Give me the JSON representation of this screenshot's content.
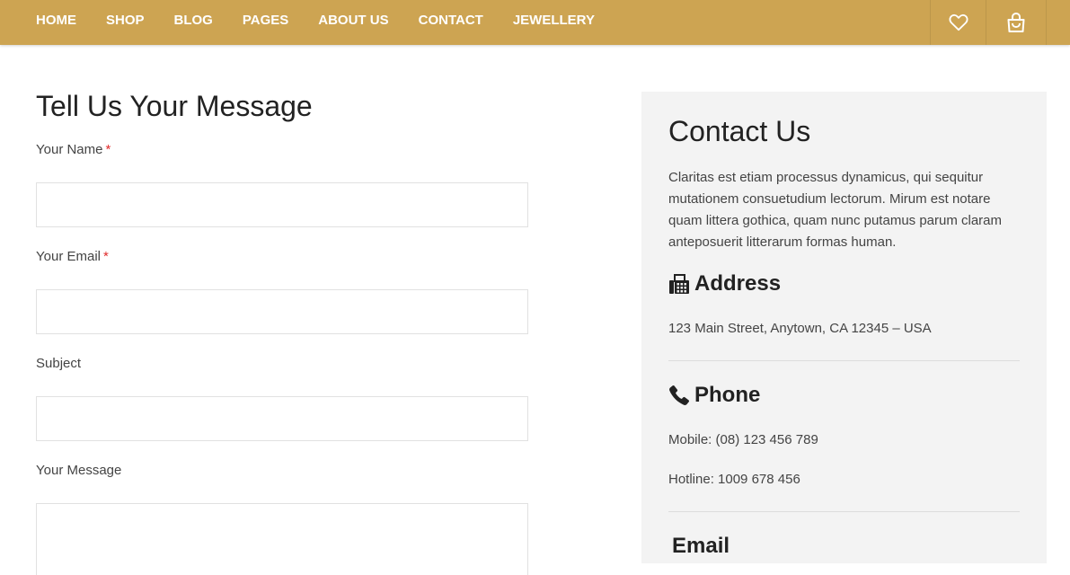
{
  "nav": {
    "links": [
      "HOME",
      "SHOP",
      "BLOG",
      "PAGES",
      "ABOUT US",
      "CONTACT",
      "JEWELLERY"
    ],
    "icons": [
      "heart-icon",
      "shopping-bag-icon"
    ]
  },
  "form": {
    "title": "Tell Us Your Message",
    "name_label": "Your Name",
    "name_required": "*",
    "email_label": "Your Email",
    "email_required": "*",
    "subject_label": "Subject",
    "message_label": "Your Message"
  },
  "contact": {
    "title": "Contact Us",
    "description": "Claritas est etiam processus dynamicus, qui sequitur mutationem consuetudium lectorum. Mirum est notare quam littera gothica, quam nunc putamus parum claram anteposuerit litterarum formas human.",
    "address": {
      "heading": "Address",
      "icon": "fax-icon",
      "text": "123 Main Street, Anytown, CA 12345 – USA"
    },
    "phone": {
      "heading": "Phone",
      "icon": "phone-icon",
      "mobile": "Mobile: (08) 123 456 789",
      "hotline": "Hotline: 1009 678 456"
    },
    "email": {
      "heading": "Email"
    }
  },
  "colors": {
    "nav_background": "#cda452",
    "panel_background": "#f3f3f3",
    "required_marker": "#e02b2b"
  }
}
